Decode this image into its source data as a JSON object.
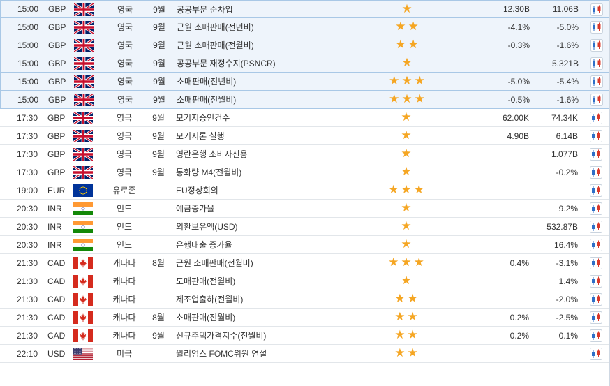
{
  "calendar": {
    "rows": [
      {
        "time": "15:00",
        "currency": "GBP",
        "flag": "uk-flag",
        "country": "영국",
        "period": "9월",
        "event": "공공부문 순차입",
        "stars": 1,
        "actual": "12.30B",
        "forecast": "11.06B",
        "highlighted": true
      },
      {
        "time": "15:00",
        "currency": "GBP",
        "flag": "uk-flag",
        "country": "영국",
        "period": "9월",
        "event": "근원 소매판매(전년비)",
        "stars": 2,
        "actual": "-4.1%",
        "forecast": "-5.0%",
        "highlighted": true
      },
      {
        "time": "15:00",
        "currency": "GBP",
        "flag": "uk-flag",
        "country": "영국",
        "period": "9월",
        "event": "근원 소매판매(전월비)",
        "stars": 2,
        "actual": "-0.3%",
        "forecast": "-1.6%",
        "highlighted": true
      },
      {
        "time": "15:00",
        "currency": "GBP",
        "flag": "uk-flag",
        "country": "영국",
        "period": "9월",
        "event": "공공부문 재정수지(PSNCR)",
        "stars": 1,
        "actual": "",
        "forecast": "5.321B",
        "highlighted": true
      },
      {
        "time": "15:00",
        "currency": "GBP",
        "flag": "uk-flag",
        "country": "영국",
        "period": "9월",
        "event": "소매판매(전년비)",
        "stars": 3,
        "actual": "-5.0%",
        "forecast": "-5.4%",
        "highlighted": true
      },
      {
        "time": "15:00",
        "currency": "GBP",
        "flag": "uk-flag",
        "country": "영국",
        "period": "9월",
        "event": "소매판매(전월비)",
        "stars": 3,
        "actual": "-0.5%",
        "forecast": "-1.6%",
        "highlighted": true
      },
      {
        "time": "17:30",
        "currency": "GBP",
        "flag": "uk-flag",
        "country": "영국",
        "period": "9월",
        "event": "모기지승인건수",
        "stars": 1,
        "actual": "62.00K",
        "forecast": "74.34K",
        "highlighted": false
      },
      {
        "time": "17:30",
        "currency": "GBP",
        "flag": "uk-flag",
        "country": "영국",
        "period": "9월",
        "event": "모기지론 실행",
        "stars": 1,
        "actual": "4.90B",
        "forecast": "6.14B",
        "highlighted": false
      },
      {
        "time": "17:30",
        "currency": "GBP",
        "flag": "uk-flag",
        "country": "영국",
        "period": "9월",
        "event": "영란은행 소비자신용",
        "stars": 1,
        "actual": "",
        "forecast": "1.077B",
        "highlighted": false
      },
      {
        "time": "17:30",
        "currency": "GBP",
        "flag": "uk-flag",
        "country": "영국",
        "period": "9월",
        "event": "통화량 M4(전월비)",
        "stars": 1,
        "actual": "",
        "forecast": "-0.2%",
        "highlighted": false
      },
      {
        "time": "19:00",
        "currency": "EUR",
        "flag": "eu-flag",
        "country": "유로존",
        "period": "",
        "event": "EU정상회의",
        "stars": 3,
        "actual": "",
        "forecast": "",
        "highlighted": false
      },
      {
        "time": "20:30",
        "currency": "INR",
        "flag": "india-flag",
        "country": "인도",
        "period": "",
        "event": "예금증가율",
        "stars": 1,
        "actual": "",
        "forecast": "9.2%",
        "highlighted": false
      },
      {
        "time": "20:30",
        "currency": "INR",
        "flag": "india-flag",
        "country": "인도",
        "period": "",
        "event": "외환보유액(USD)",
        "stars": 1,
        "actual": "",
        "forecast": "532.87B",
        "highlighted": false
      },
      {
        "time": "20:30",
        "currency": "INR",
        "flag": "india-flag",
        "country": "인도",
        "period": "",
        "event": "은행대출 증가율",
        "stars": 1,
        "actual": "",
        "forecast": "16.4%",
        "highlighted": false
      },
      {
        "time": "21:30",
        "currency": "CAD",
        "flag": "canada-flag",
        "country": "캐나다",
        "period": "8월",
        "event": "근원 소매판매(전월비)",
        "stars": 3,
        "actual": "0.4%",
        "forecast": "-3.1%",
        "highlighted": false
      },
      {
        "time": "21:30",
        "currency": "CAD",
        "flag": "canada-flag",
        "country": "캐나다",
        "period": "",
        "event": "도매판매(전월비)",
        "stars": 1,
        "actual": "",
        "forecast": "1.4%",
        "highlighted": false
      },
      {
        "time": "21:30",
        "currency": "CAD",
        "flag": "canada-flag",
        "country": "캐나다",
        "period": "",
        "event": "제조업출하(전월비)",
        "stars": 2,
        "actual": "",
        "forecast": "-2.0%",
        "highlighted": false
      },
      {
        "time": "21:30",
        "currency": "CAD",
        "flag": "canada-flag",
        "country": "캐나다",
        "period": "8월",
        "event": "소매판매(전월비)",
        "stars": 2,
        "actual": "0.2%",
        "forecast": "-2.5%",
        "highlighted": false
      },
      {
        "time": "21:30",
        "currency": "CAD",
        "flag": "canada-flag",
        "country": "캐나다",
        "period": "9월",
        "event": "신규주택가격지수(전월비)",
        "stars": 2,
        "actual": "0.2%",
        "forecast": "0.1%",
        "highlighted": false
      },
      {
        "time": "22:10",
        "currency": "USD",
        "flag": "usa-flag",
        "country": "미국",
        "period": "",
        "event": "윌리엄스 FOMC위원 연설",
        "stars": 2,
        "actual": "",
        "forecast": "",
        "highlighted": false
      }
    ],
    "chart_icon": "candlestick-chart-icon",
    "star_icon": "star-icon",
    "colors": {
      "highlight_bg": "#eef4fb",
      "highlight_border": "#a9c8e6",
      "star": "#f5a623",
      "candle_blue": "#2e6fc8",
      "candle_red": "#d9382b"
    }
  }
}
